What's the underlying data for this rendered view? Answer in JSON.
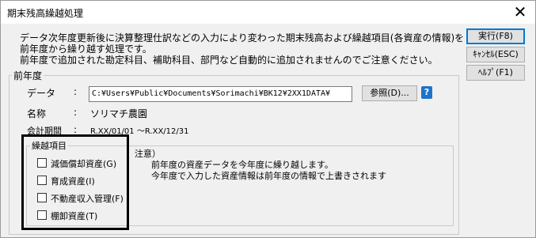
{
  "window": {
    "title": "期末残高繰越処理",
    "close_glyph": "✕"
  },
  "description": [
    "データ次年度更新後に決算整理仕訳などの入力により変わった期末残高および繰越項目(各資産の情報)を",
    "前年度から繰り越す処理です。",
    "前年度で追加された勘定科目、補助科目、部門など自動的に追加されませんのでご注意ください。"
  ],
  "buttons": {
    "execute": "実行(F8)",
    "cancel": "ｷｬﾝｾﾙ(ESC)",
    "help": "ﾍﾙﾌﾟ(F1)"
  },
  "prev_year": {
    "group_title": "前年度",
    "data_label": "データ",
    "colon": ":",
    "data_path": "C:¥Users¥Public¥Documents¥Sorimachi¥BK12¥2XX1DATA¥",
    "browse_label": "参照(D)...",
    "help_icon": "?",
    "name_label": "名称",
    "name_value": "ソリマチ農園",
    "period_label": "会計期間",
    "period_value": "R.XX/01/01 ～R.XX/12/31"
  },
  "carry_items": {
    "group_title": "繰越項目",
    "items": [
      {
        "label": "減価償却資産(G)",
        "checked": false
      },
      {
        "label": "育成資産(I)",
        "checked": false
      },
      {
        "label": "不動産収入管理(F)",
        "checked": false
      },
      {
        "label": "棚卸資産(T)",
        "checked": false
      }
    ]
  },
  "note": {
    "title": "注意）",
    "line1": "前年度の資産データを今年度に繰り越します。",
    "line2": "今年度で入力した資産情報は前年度の情報で上書きされます"
  }
}
